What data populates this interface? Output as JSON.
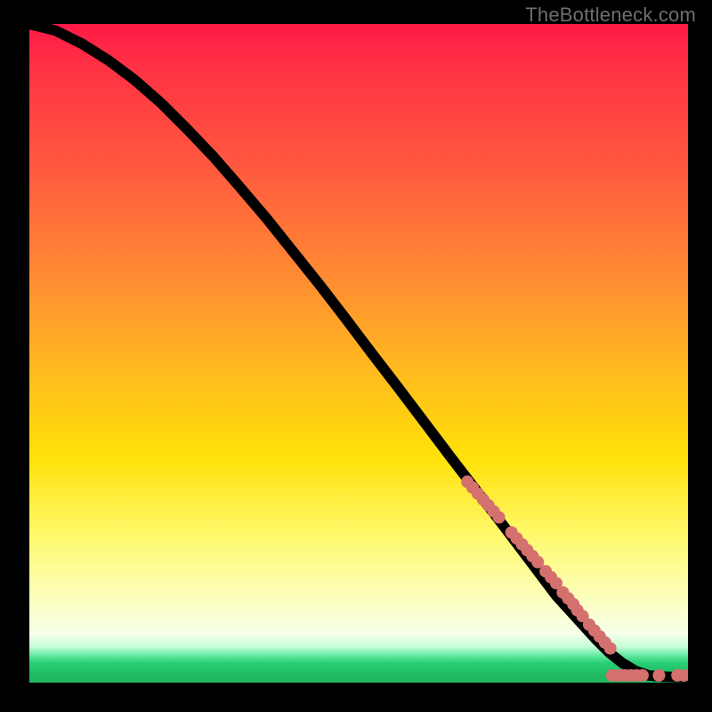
{
  "watermark": "TheBottleneck.com",
  "colors": {
    "dot": "#d4706e",
    "curve": "#000000",
    "gradient_top": "#ff1a47",
    "gradient_bottom": "#1fb85f",
    "frame": "#000000"
  },
  "chart_data": {
    "type": "line",
    "title": "",
    "xlabel": "",
    "ylabel": "",
    "xlim": [
      0,
      100
    ],
    "ylim": [
      0,
      100
    ],
    "grid": false,
    "curve": {
      "x": [
        0,
        4,
        8,
        12,
        16,
        20,
        24,
        28,
        32,
        36,
        40,
        44,
        48,
        52,
        56,
        60,
        64,
        68,
        72,
        76,
        80,
        82,
        84,
        86,
        88,
        90,
        92,
        94,
        96,
        98,
        100
      ],
      "y": [
        100,
        99,
        97,
        94.5,
        91.5,
        88,
        84,
        79.8,
        75.2,
        70.5,
        65.5,
        60.5,
        55.3,
        50,
        44.8,
        39.5,
        34.2,
        29,
        23.8,
        18.5,
        13.2,
        11,
        8.8,
        6.6,
        4.6,
        3.0,
        1.8,
        1.1,
        0.9,
        0.85,
        0.82
      ]
    },
    "dots": [
      {
        "x": 66.5,
        "y": 30.5
      },
      {
        "x": 67.3,
        "y": 29.6
      },
      {
        "x": 68.1,
        "y": 28.7
      },
      {
        "x": 68.9,
        "y": 27.8
      },
      {
        "x": 69.7,
        "y": 26.9
      },
      {
        "x": 70.5,
        "y": 26.0
      },
      {
        "x": 71.3,
        "y": 25.1
      },
      {
        "x": 73.2,
        "y": 22.8
      },
      {
        "x": 74.0,
        "y": 21.9
      },
      {
        "x": 74.8,
        "y": 21.0
      },
      {
        "x": 75.6,
        "y": 20.1
      },
      {
        "x": 76.4,
        "y": 19.2
      },
      {
        "x": 77.2,
        "y": 18.3
      },
      {
        "x": 78.4,
        "y": 16.9
      },
      {
        "x": 79.2,
        "y": 16.0
      },
      {
        "x": 80.0,
        "y": 15.1
      },
      {
        "x": 81.0,
        "y": 13.7
      },
      {
        "x": 81.8,
        "y": 12.8
      },
      {
        "x": 82.6,
        "y": 11.9
      },
      {
        "x": 83.2,
        "y": 11.0
      },
      {
        "x": 84.0,
        "y": 10.1
      },
      {
        "x": 85.0,
        "y": 8.8
      },
      {
        "x": 85.8,
        "y": 7.9
      },
      {
        "x": 86.6,
        "y": 7.0
      },
      {
        "x": 87.4,
        "y": 6.1
      },
      {
        "x": 88.2,
        "y": 5.2
      },
      {
        "x": 88.5,
        "y": 1.1
      },
      {
        "x": 89.5,
        "y": 1.1
      },
      {
        "x": 90.4,
        "y": 1.1
      },
      {
        "x": 91.3,
        "y": 1.1
      },
      {
        "x": 92.2,
        "y": 1.1
      },
      {
        "x": 93.1,
        "y": 1.1
      },
      {
        "x": 95.6,
        "y": 1.1
      },
      {
        "x": 98.4,
        "y": 1.1
      },
      {
        "x": 99.4,
        "y": 1.1
      }
    ]
  }
}
